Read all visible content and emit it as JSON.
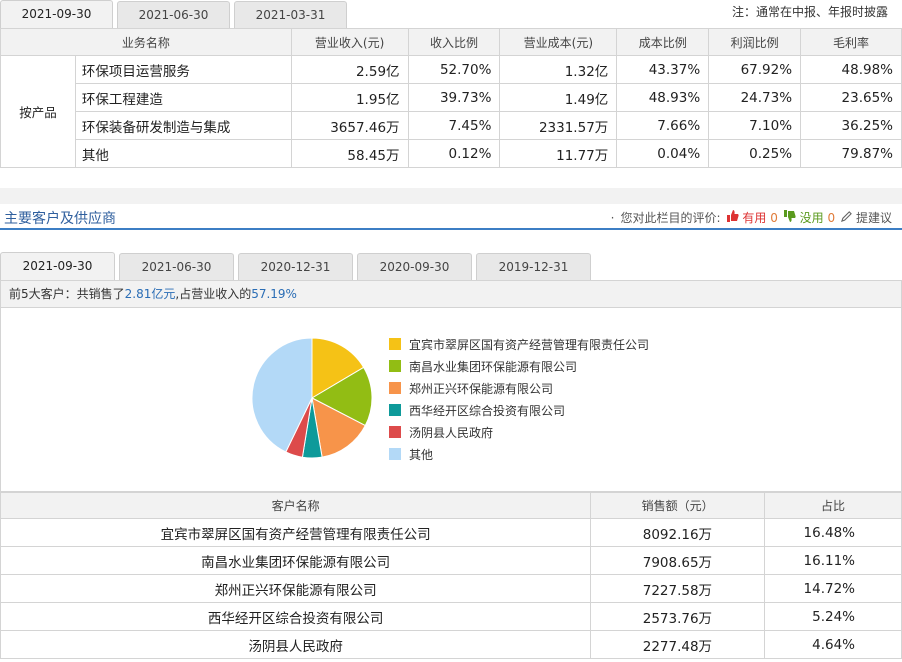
{
  "top_tabs": [
    "2021-09-30",
    "2021-06-30",
    "2021-03-31"
  ],
  "note": "注：通常在中报、年报时披露",
  "biz_table": {
    "headers": [
      "业务名称",
      "营业收入(元)",
      "收入比例",
      "营业成本(元)",
      "成本比例",
      "利润比例",
      "毛利率"
    ],
    "category": "按产品",
    "rows": [
      [
        "环保项目运营服务",
        "2.59亿",
        "52.70%",
        "1.32亿",
        "43.37%",
        "67.92%",
        "48.98%"
      ],
      [
        "环保工程建造",
        "1.95亿",
        "39.73%",
        "1.49亿",
        "48.93%",
        "24.73%",
        "23.65%"
      ],
      [
        "环保装备研发制造与集成",
        "3657.46万",
        "7.45%",
        "2331.57万",
        "7.66%",
        "7.10%",
        "36.25%"
      ],
      [
        "其他",
        "58.45万",
        "0.12%",
        "11.77万",
        "0.04%",
        "0.25%",
        "79.87%"
      ]
    ]
  },
  "section": {
    "title": "主要客户及供应商",
    "rating_prompt": "您对此栏目的评价:",
    "useful_label": "有用",
    "useful_count": "0",
    "useless_label": "没用",
    "useless_count": "0",
    "suggest_label": "提建议"
  },
  "cust_tabs": [
    "2021-09-30",
    "2021-06-30",
    "2020-12-31",
    "2020-09-30",
    "2019-12-31"
  ],
  "summary": {
    "prefix": "前5大客户：共销售了",
    "amount": "2.81亿元",
    "middle": ",占营业收入的",
    "percent": "57.19%"
  },
  "chart_data": {
    "type": "pie",
    "labels": [
      "宜宾市翠屏区国有资产经营管理有限责任公司",
      "南昌水业集团环保能源有限公司",
      "郑州正兴环保能源有限公司",
      "西华经开区综合投资有限公司",
      "汤阴县人民政府",
      "其他"
    ],
    "values": [
      16.48,
      16.11,
      14.72,
      5.24,
      4.64,
      42.81
    ],
    "colors": [
      "#f5c216",
      "#92bd14",
      "#f7944a",
      "#0e9a9a",
      "#dd4b4b",
      "#b3d9f7"
    ],
    "legend_position": "right"
  },
  "cust_table": {
    "headers": [
      "客户名称",
      "销售额（元）",
      "占比"
    ],
    "rows": [
      [
        "宜宾市翠屏区国有资产经营管理有限责任公司",
        "8092.16万",
        "16.48%"
      ],
      [
        "南昌水业集团环保能源有限公司",
        "7908.65万",
        "16.11%"
      ],
      [
        "郑州正兴环保能源有限公司",
        "7227.58万",
        "14.72%"
      ],
      [
        "西华经开区综合投资有限公司",
        "2573.76万",
        "5.24%"
      ],
      [
        "汤阴县人民政府",
        "2277.48万",
        "4.64%"
      ]
    ]
  }
}
